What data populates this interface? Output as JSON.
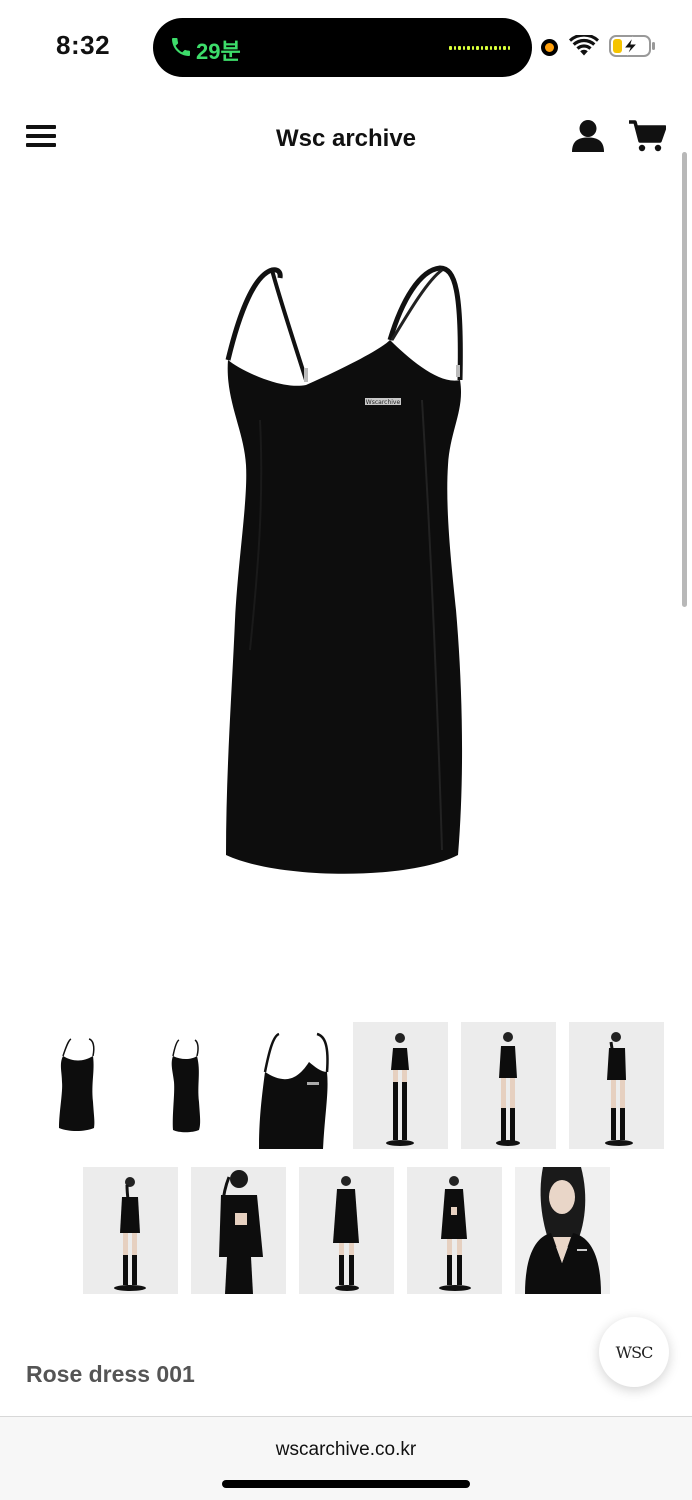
{
  "status_bar": {
    "time": "8:32",
    "call_duration": "29분",
    "icons": [
      "phone-icon",
      "recording-dot",
      "wifi-icon",
      "battery-charging-icon"
    ]
  },
  "header": {
    "title": "Wsc archive",
    "icons": [
      "menu-icon",
      "user-icon",
      "cart-icon"
    ]
  },
  "main_image": {
    "dress_logo": "Wscarchive"
  },
  "gallery": {
    "row1": [
      "dress-front",
      "dress-side",
      "dress-closeup",
      "model-front",
      "model-front-2",
      "model-side"
    ],
    "row2": [
      "model-back",
      "model-cardigan-back",
      "model-cardigan-front",
      "model-back-2",
      "model-closeup"
    ]
  },
  "product": {
    "name": "Rose dress 001"
  },
  "chat_button": {
    "label": "WSC"
  },
  "browser": {
    "url": "wscarchive.co.kr"
  },
  "colors": {
    "call_green": "#3ddc6a",
    "recording_orange": "#ff9f0a",
    "product_name": "#555555"
  }
}
